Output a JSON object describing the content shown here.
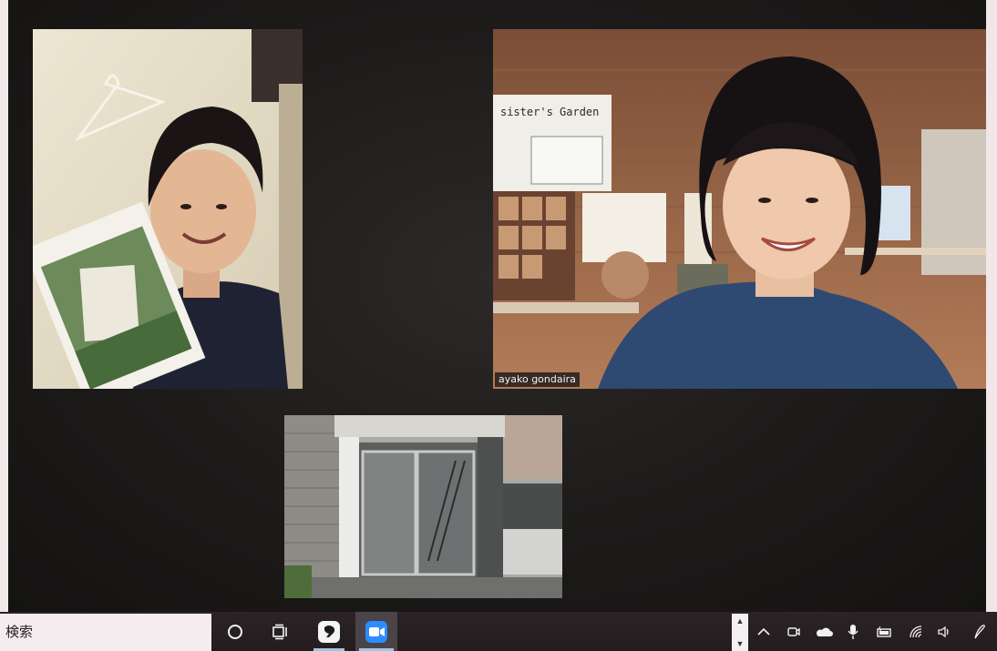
{
  "meeting": {
    "participants": [
      {
        "id": "left",
        "name": ""
      },
      {
        "id": "right",
        "name": "ayako gondaira"
      },
      {
        "id": "bottom",
        "name": ""
      }
    ],
    "scene_text": {
      "garden_sign": "sister's Garden"
    }
  },
  "taskbar": {
    "search_text": "検索",
    "apps": [
      {
        "name": "cortana-icon"
      },
      {
        "name": "task-view-icon"
      },
      {
        "name": "chat-app-icon"
      },
      {
        "name": "zoom-app-icon",
        "active": true
      }
    ],
    "tray": [
      "chevron-up-icon",
      "meet-now-icon",
      "onedrive-icon",
      "microphone-icon",
      "battery-icon",
      "wifi-icon",
      "volume-icon",
      "pen-icon"
    ]
  },
  "colors": {
    "meeting_background": "#1d1b1a",
    "taskbar": "#2b2327",
    "zoom_blue": "#2d8cff",
    "active_indicator": "#9ec6e6"
  }
}
